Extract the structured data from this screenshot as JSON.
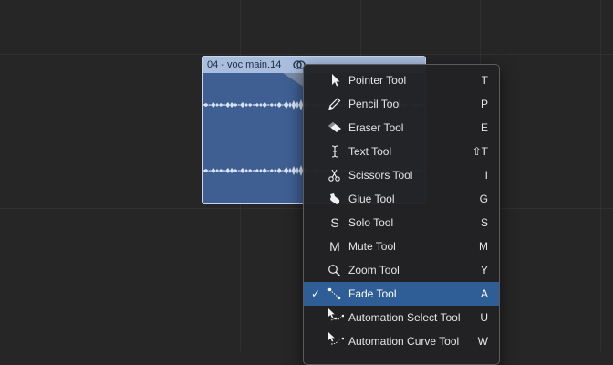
{
  "region": {
    "title": "04 - voc main.14",
    "color": "#3f5f93",
    "header_color": "#a9bedf"
  },
  "menu": {
    "items": [
      {
        "label": "Pointer Tool",
        "shortcut": "T",
        "icon": "pointer-icon",
        "checked": false
      },
      {
        "label": "Pencil Tool",
        "shortcut": "P",
        "icon": "pencil-icon",
        "checked": false
      },
      {
        "label": "Eraser Tool",
        "shortcut": "E",
        "icon": "eraser-icon",
        "checked": false
      },
      {
        "label": "Text Tool",
        "shortcut": "⇧T",
        "icon": "text-cursor-icon",
        "checked": false
      },
      {
        "label": "Scissors Tool",
        "shortcut": "I",
        "icon": "scissors-icon",
        "checked": false
      },
      {
        "label": "Glue Tool",
        "shortcut": "G",
        "icon": "glue-icon",
        "checked": false
      },
      {
        "label": "Solo Tool",
        "shortcut": "S",
        "icon": "solo-icon",
        "icon_glyph": "S",
        "checked": false
      },
      {
        "label": "Mute Tool",
        "shortcut": "M",
        "icon": "mute-icon",
        "icon_glyph": "M",
        "checked": false
      },
      {
        "label": "Zoom Tool",
        "shortcut": "Y",
        "icon": "zoom-icon",
        "checked": false
      },
      {
        "label": "Fade Tool",
        "shortcut": "A",
        "icon": "fade-icon",
        "checked": true,
        "check_mark": "✓"
      },
      {
        "label": "Automation Select Tool",
        "shortcut": "U",
        "icon": "automation-select-icon",
        "checked": false
      },
      {
        "label": "Automation Curve Tool",
        "shortcut": "W",
        "icon": "automation-curve-icon",
        "checked": false
      }
    ],
    "selected_color": "#2f5d96"
  }
}
